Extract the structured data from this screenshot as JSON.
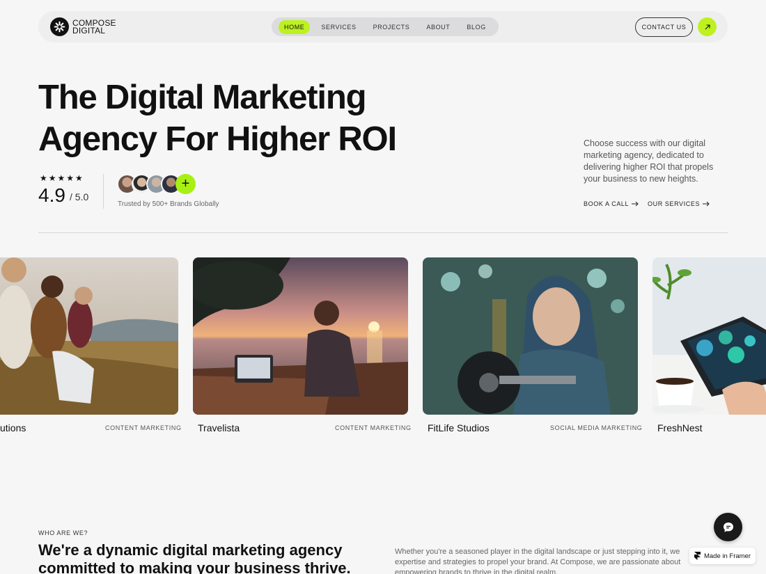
{
  "brand": {
    "line1": "COMPOSE",
    "line2": "DIGITAL",
    "accent": "#bdf11f"
  },
  "nav": {
    "items": [
      {
        "label": "HOME",
        "active": true
      },
      {
        "label": "SERVICES"
      },
      {
        "label": "PROJECTS"
      },
      {
        "label": "ABOUT"
      },
      {
        "label": "BLOG"
      }
    ],
    "contact_label": "CONTACT US",
    "cta_icon": "arrow-up-right-icon"
  },
  "hero": {
    "title_line1": "The Digital Marketing",
    "title_line2": "Agency For Higher ROI",
    "stars": "★★★★★",
    "rating": "4.9",
    "rating_max": "/ 5.0",
    "plus": "+",
    "trusted": "Trusted by 500+ Brands Globally",
    "description": "Choose success with our digital marketing agency, dedicated to delivering higher ROI that propels your business to new heights.",
    "link_call": "BOOK A CALL",
    "link_services": "OUR SERVICES"
  },
  "projects": [
    {
      "name": "utions",
      "tag": "CONTENT MARKETING"
    },
    {
      "name": "Travelista",
      "tag": "CONTENT MARKETING"
    },
    {
      "name": "FitLife Studios",
      "tag": "SOCIAL MEDIA MARKETING"
    },
    {
      "name": "FreshNest",
      "tag": ""
    }
  ],
  "about": {
    "eyebrow": "WHO ARE WE?",
    "title": "We're a dynamic digital marketing agency committed to making your business thrive.",
    "text": "Whether you're a seasoned player in the digital landscape or just stepping into it, we expertise and strategies to propel your brand. At Compose, we are passionate about empowering brands to thrive in the digital realm."
  },
  "framer_badge": "Made in Framer"
}
